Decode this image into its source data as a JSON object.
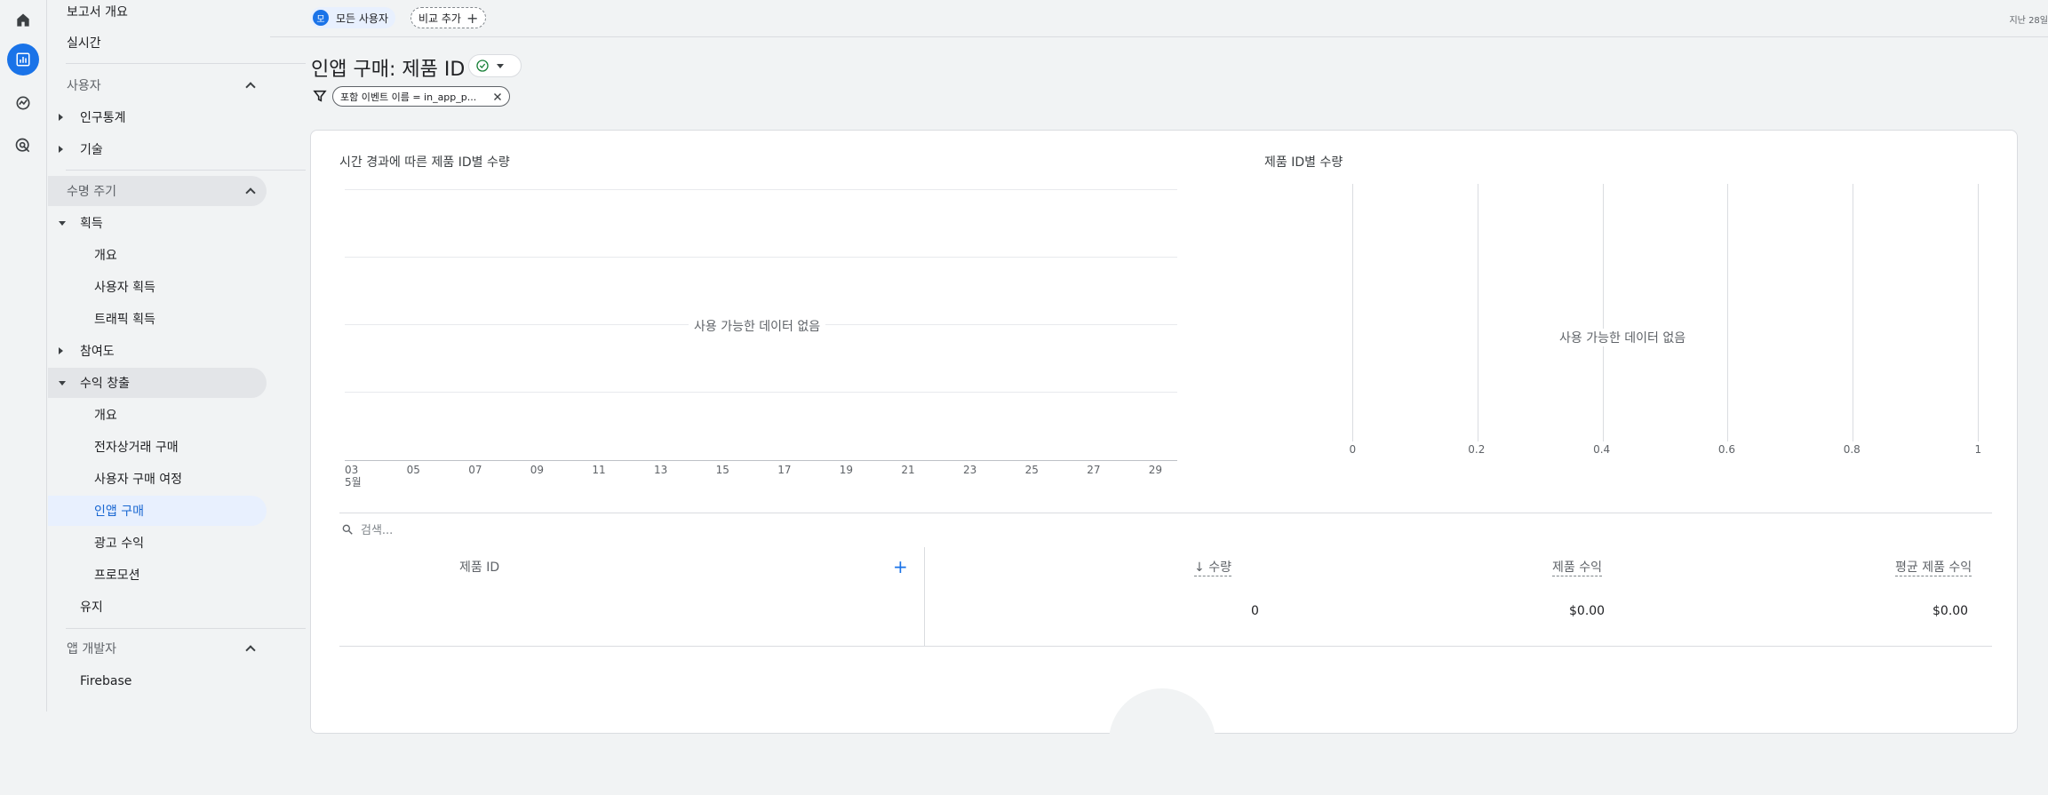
{
  "rail": {
    "icons": [
      "home-icon",
      "reports-icon",
      "explore-icon",
      "advertising-icon"
    ]
  },
  "nav": {
    "report_overview": "보고서 개요",
    "realtime": "실시간",
    "user_section": "사용자",
    "demographics": "인구통계",
    "tech": "기술",
    "lifecycle_section": "수명 주기",
    "acquisition": "획득",
    "acq_overview": "개요",
    "user_acquisition": "사용자 획득",
    "traffic_acquisition": "트래픽 획득",
    "engagement": "참여도",
    "monetization": "수익 창출",
    "mon_overview": "개요",
    "ecommerce": "전자상거래 구매",
    "purchase_journey": "사용자 구매 여정",
    "in_app_purchases": "인앱 구매",
    "ad_revenue": "광고 수익",
    "promotions": "프로모션",
    "retention": "유지",
    "app_dev_section": "앱 개발자",
    "firebase": "Firebase"
  },
  "topbar": {
    "all_users_avatar": "모",
    "all_users": "모든 사용자",
    "add_comparison": "비교 추가",
    "date_range": "지난 28일"
  },
  "page": {
    "title": "인앱 구매: 제품 ID",
    "filter_label": "포함 이벤트 이름 = in_app_p..."
  },
  "line_chart": {
    "title": "시간 경과에 따른 제품 ID별 수량",
    "no_data": "사용 가능한 데이터 없음",
    "x_ticks": [
      "03",
      "05",
      "07",
      "09",
      "11",
      "13",
      "15",
      "17",
      "19",
      "21",
      "23",
      "25",
      "27",
      "29"
    ],
    "month_label": "5월"
  },
  "bar_chart": {
    "title": "제품 ID별 수량",
    "no_data": "사용 가능한 데이터 없음",
    "x_ticks": [
      "0",
      "0.2",
      "0.4",
      "0.6",
      "0.8",
      "1"
    ]
  },
  "chart_data": [
    {
      "type": "line",
      "title": "시간 경과에 따른 제품 ID별 수량",
      "categories": [
        "03",
        "05",
        "07",
        "09",
        "11",
        "13",
        "15",
        "17",
        "19",
        "21",
        "23",
        "25",
        "27",
        "29"
      ],
      "series": []
    },
    {
      "type": "bar",
      "title": "제품 ID별 수량",
      "xlim": [
        0,
        1
      ],
      "series": []
    }
  ],
  "table": {
    "search_placeholder": "검색...",
    "headers": {
      "product_id": "제품 ID",
      "quantity": "수량",
      "product_revenue": "제품 수익",
      "avg_product_revenue": "평균 제품 수익"
    },
    "totals": {
      "quantity": "0",
      "product_revenue": "$0.00",
      "avg_product_revenue": "$0.00"
    }
  }
}
